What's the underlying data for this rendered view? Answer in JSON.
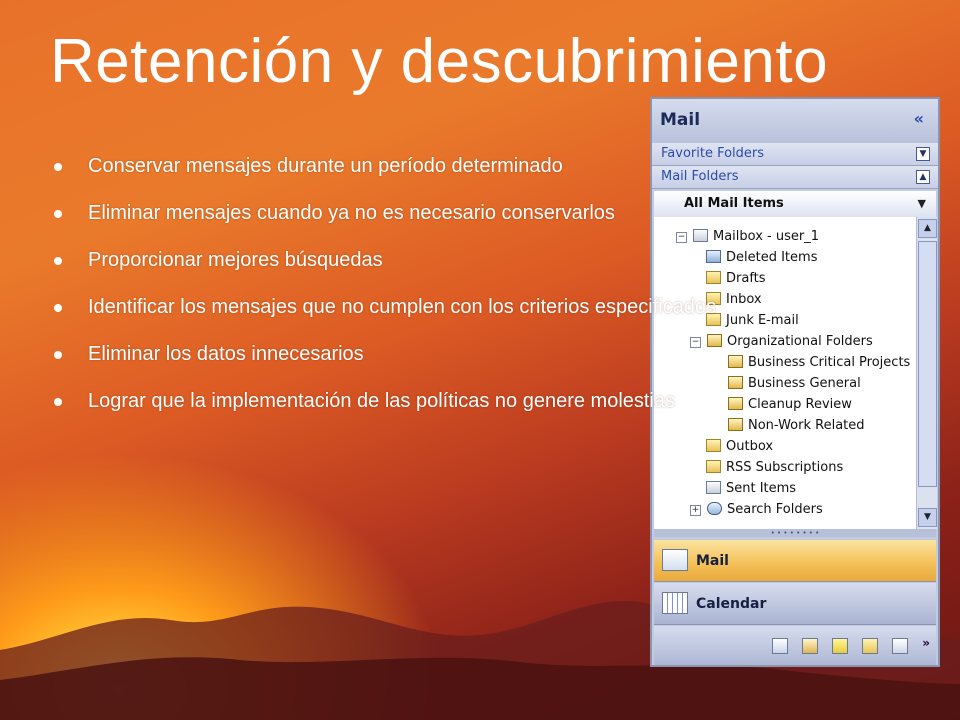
{
  "slide": {
    "title": "Retención y descubrimiento",
    "bullets": [
      "Conservar mensajes durante un período determinado",
      "Eliminar mensajes cuando ya no es necesario conservarlos",
      "Proporcionar mejores búsquedas",
      "Identificar los mensajes que no cumplen con los criterios especificados",
      "Eliminar los datos innecesarios",
      "Lograr que la implementación de las políticas no genere molestias"
    ]
  },
  "outlook": {
    "header": "Mail",
    "collapse_glyph": "«",
    "favorite_folders": "Favorite Folders",
    "mail_folders": "Mail Folders",
    "all_mail_items": "All Mail Items",
    "tree": {
      "mailbox": "Mailbox - user_1",
      "deleted": "Deleted Items",
      "drafts": "Drafts",
      "inbox": "Inbox",
      "junk": "Junk E-mail",
      "org": "Organizational Folders",
      "bcp": "Business Critical Projects",
      "bg": "Business General",
      "cr": "Cleanup Review",
      "nwr": "Non-Work Related",
      "outbox": "Outbox",
      "rss": "RSS Subscriptions",
      "sent": "Sent Items",
      "search": "Search Folders"
    },
    "nav_mail": "Mail",
    "nav_calendar": "Calendar",
    "more_glyph": "»"
  },
  "colors": {
    "accent_mail": "#f3c25a",
    "pane_bg": "#c3cbe0"
  }
}
